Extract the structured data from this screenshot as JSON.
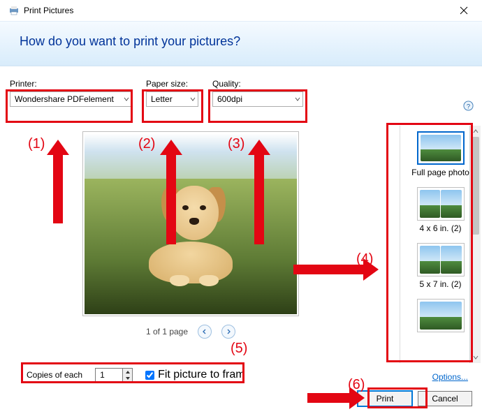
{
  "window": {
    "title": "Print Pictures",
    "heading": "How do you want to print your pictures?"
  },
  "fields": {
    "printer": {
      "label": "Printer:",
      "value": "Wondershare PDFelement"
    },
    "paper": {
      "label": "Paper size:",
      "value": "Letter"
    },
    "quality": {
      "label": "Quality:",
      "value": "600dpi"
    }
  },
  "preview": {
    "nav_text": "1 of 1 page"
  },
  "layouts": {
    "items": [
      {
        "name": "Full page photo"
      },
      {
        "name": "4 x 6 in. (2)"
      },
      {
        "name": "5 x 7 in. (2)"
      },
      {
        "name": ""
      }
    ],
    "selected_index": 0
  },
  "bottom": {
    "copies_label": "Copies of each",
    "copies_value": "1",
    "fit_label": "Fit picture to fram",
    "fit_checked": true,
    "options_link": "Options..."
  },
  "buttons": {
    "primary": "Print",
    "cancel": "Cancel"
  },
  "annotations": {
    "n1": "(1)",
    "n2": "(2)",
    "n3": "(3)",
    "n4": "(4)",
    "n5": "(5)",
    "n6": "(6)"
  }
}
